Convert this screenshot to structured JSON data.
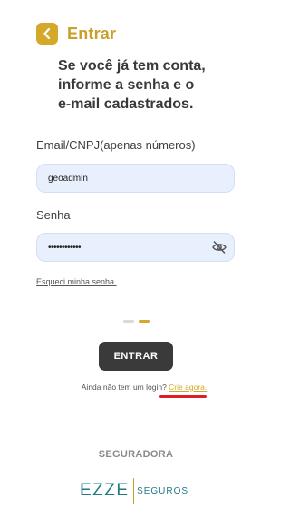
{
  "header": {
    "title": "Entrar",
    "back_icon": "chevron-left-icon"
  },
  "intro": {
    "line1": "Se você já tem conta,",
    "line2": "informe a senha e o",
    "line3": "e-mail cadastrados."
  },
  "form": {
    "email_label": "Email/CNPJ(apenas números)",
    "email_value": "geoadmin",
    "password_label": "Senha",
    "password_value": "••••••••••••",
    "password_toggle_icon": "eye-slash-icon",
    "forgot_link": "Esqueci minha senha."
  },
  "pager": {
    "total": 2,
    "active_index": 1
  },
  "actions": {
    "enter_button": "ENTRAR"
  },
  "signup": {
    "prompt": "Ainda não tem um login?",
    "link": "Crie agora."
  },
  "partner": {
    "label": "SEGURADORA",
    "logo_main": "EZZE",
    "logo_sub": "SEGUROS"
  },
  "colors": {
    "accent": "#d4a82a",
    "button": "#3a3a3a",
    "input_bg": "#e8f0fe",
    "brand_teal": "#1f7a86",
    "underline_red": "#e01c24"
  }
}
